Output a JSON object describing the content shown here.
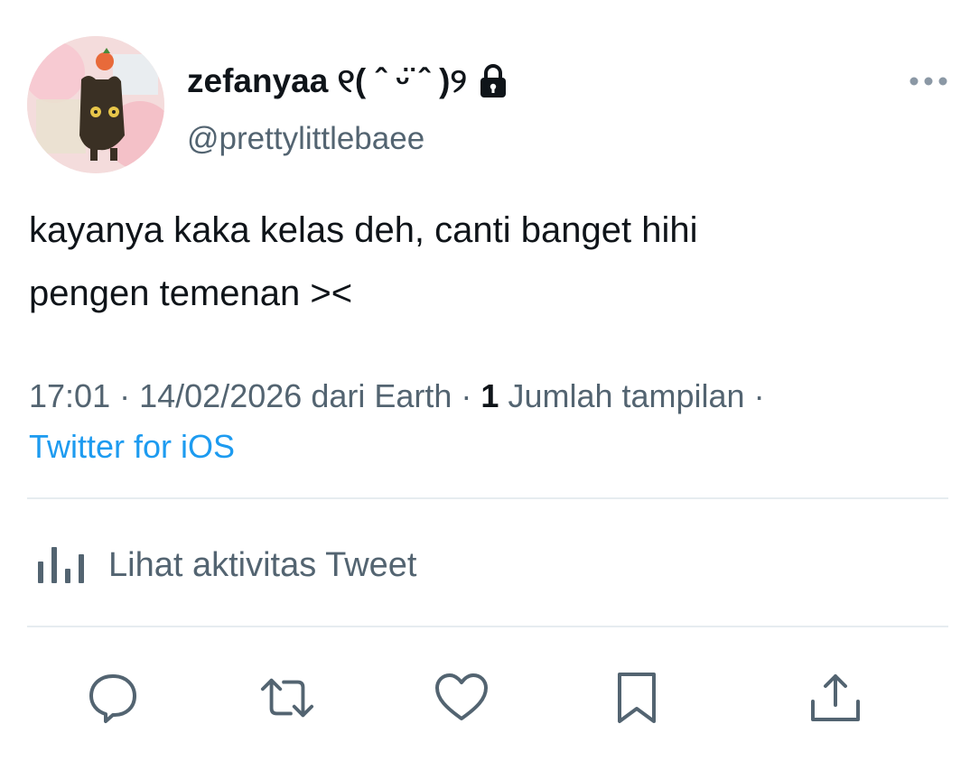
{
  "user": {
    "display_name": "zefanyaa ୧(  ˆ  ᵕ̈  ˆ  )୨",
    "handle": "@prettylittlebaee",
    "protected": true
  },
  "tweet": {
    "text_line1": "kayanya kaka kelas deh, canti banget hihi",
    "text_line2": "pengen temenan ><"
  },
  "meta": {
    "time": "17:01",
    "date": "14/02/2026",
    "location": "dari Earth",
    "views_count": "1",
    "views_label": "Jumlah tampilan",
    "source": "Twitter for iOS"
  },
  "analytics": {
    "label": "Lihat aktivitas Tweet"
  },
  "icons": {
    "more": "more-horizontal-icon",
    "lock": "lock-icon",
    "analytics": "bar-chart-icon",
    "reply": "reply-icon",
    "retweet": "retweet-icon",
    "like": "heart-icon",
    "bookmark": "bookmark-icon",
    "share": "share-icon"
  },
  "colors": {
    "text": "#0f1419",
    "secondary": "#536471",
    "link": "#1d9bf0",
    "divider": "#e6ecf0"
  }
}
